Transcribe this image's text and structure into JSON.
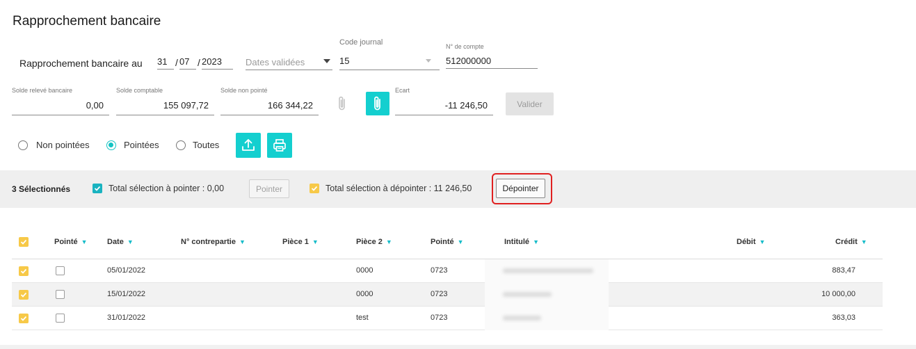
{
  "page": {
    "title": "Rapprochement bancaire"
  },
  "header": {
    "rapprochement_label": "Rapprochement bancaire au",
    "date_day": "31",
    "date_month": "07",
    "date_year": "2023",
    "date_sep": "/",
    "dates_validees_placeholder": "Dates validées",
    "code_journal_label": "Code journal",
    "code_journal_value": "15",
    "compte_label": "N° de compte",
    "compte_value": "512000000"
  },
  "soldes": {
    "releve_label": "Solde relevé bancaire",
    "releve_value": "0,00",
    "comptable_label": "Solde comptable",
    "comptable_value": "155 097,72",
    "non_pointe_label": "Solde non pointé",
    "non_pointe_value": "166 344,22",
    "ecart_label": "Ecart",
    "ecart_value": "-11 246,50",
    "valider_label": "Valider"
  },
  "filters": {
    "options": [
      {
        "label": "Non pointées",
        "selected": false
      },
      {
        "label": "Pointées",
        "selected": true
      },
      {
        "label": "Toutes",
        "selected": false
      }
    ]
  },
  "selection_bar": {
    "count_label": "3 Sélectionnés",
    "total_pointer_label": "Total sélection à pointer : 0,00",
    "pointer_button": "Pointer",
    "total_depointer_label": "Total sélection à dépointer : 11 246,50",
    "depointer_button": "Dépointer"
  },
  "table": {
    "columns": [
      "Pointé",
      "Date",
      "N° contrepartie",
      "Pièce 1",
      "Pièce 2",
      "Pointé",
      "Intitulé",
      "Débit",
      "Crédit"
    ],
    "rows": [
      {
        "date": "05/01/2022",
        "contrepartie": "",
        "piece1": "",
        "piece2": "0000",
        "pointe": "0723",
        "debit": "",
        "credit": "883,47"
      },
      {
        "date": "15/01/2022",
        "contrepartie": "",
        "piece1": "",
        "piece2": "0000",
        "pointe": "0723",
        "debit": "",
        "credit": "10 000,00"
      },
      {
        "date": "31/01/2022",
        "contrepartie": "",
        "piece1": "",
        "piece2": "test",
        "pointe": "0723",
        "debit": "",
        "credit": "363,03"
      }
    ]
  },
  "colors": {
    "accent": "#14cfcf",
    "highlight": "#e02020",
    "checkbox_yellow": "#f7c948"
  }
}
